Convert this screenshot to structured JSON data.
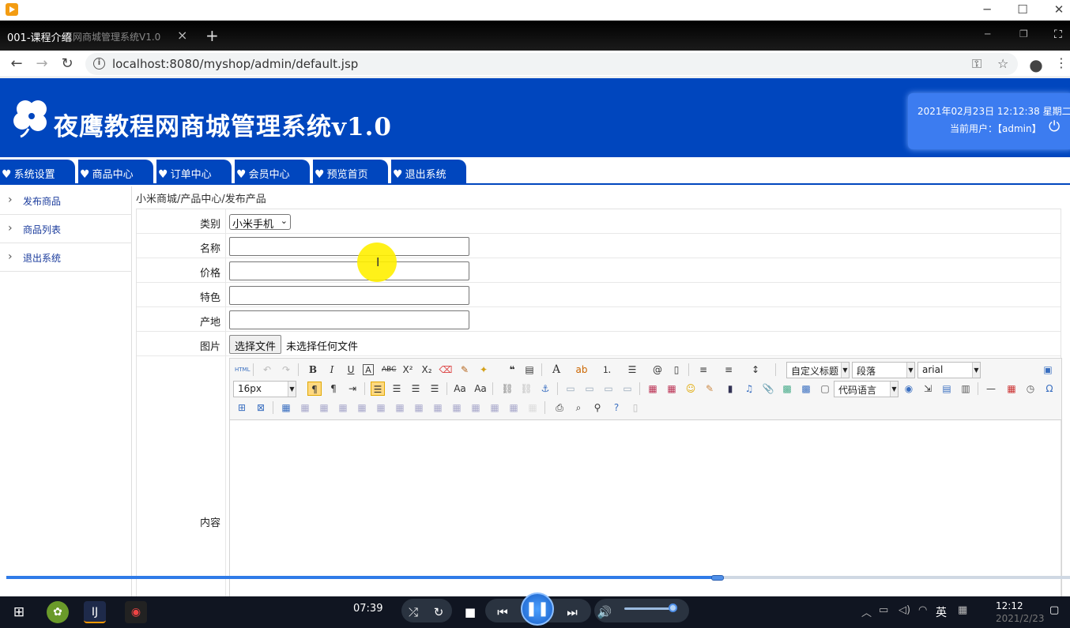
{
  "player": {
    "icon": "player-logo-icon"
  },
  "browser": {
    "tab_title": "001-课程介绍",
    "tab_ghost": "鹰网商城管理系统V1.0",
    "url": "localhost:8080/myshop/admin/default.jsp"
  },
  "header": {
    "title": "夜鹰教程网商城管理系统v1.0",
    "datetime": "2021年02月23日  12:12:38  星期二",
    "current_user": "当前用户：【admin】"
  },
  "menu": [
    {
      "label": "系统设置"
    },
    {
      "label": "商品中心"
    },
    {
      "label": "订单中心"
    },
    {
      "label": "会员中心"
    },
    {
      "label": "预览首页"
    },
    {
      "label": "退出系统"
    }
  ],
  "sidebar": [
    {
      "label": "发布商品"
    },
    {
      "label": "商品列表"
    },
    {
      "label": "退出系统"
    }
  ],
  "breadcrumb": "小米商城/产品中心/发布产品",
  "form": {
    "category_label": "类别",
    "category_value": "小米手机",
    "name_label": "名称",
    "price_label": "价格",
    "feature_label": "特色",
    "origin_label": "产地",
    "image_label": "图片",
    "file_button": "选择文件",
    "file_status": "未选择任何文件",
    "content_label": "内容"
  },
  "editor": {
    "heading_combo": "自定义标题",
    "paragraph_combo": "段落",
    "font_combo": "arial",
    "size_combo": "16px",
    "code_combo": "代码语言"
  },
  "playback": {
    "time": "07:39",
    "progress_fraction": 0.667
  },
  "tray": {
    "ime": "英",
    "clock_time": "12:12",
    "clock_date": "2021/2/23"
  }
}
